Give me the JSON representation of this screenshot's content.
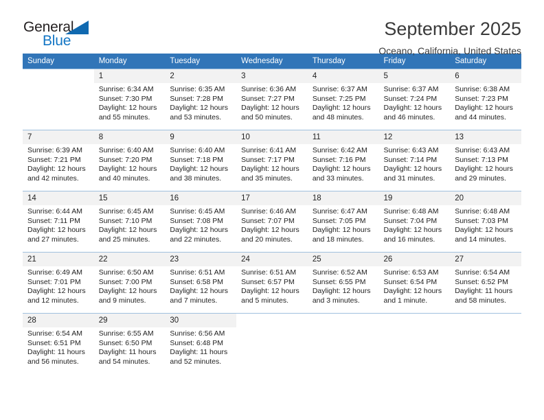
{
  "brand": {
    "name_top": "General",
    "name_bottom": "Blue",
    "triangle_color": "#1069b0",
    "blue_color": "#1275c4"
  },
  "header": {
    "title": "September 2025",
    "subtitle": "Oceano, California, United States"
  },
  "theme": {
    "header_blue": "#3175b8",
    "daynum_bg": "#f2f2f2",
    "row_divider": "#9fc0de"
  },
  "calendar": {
    "weekdays": [
      "Sunday",
      "Monday",
      "Tuesday",
      "Wednesday",
      "Thursday",
      "Friday",
      "Saturday"
    ],
    "weeks": [
      [
        {
          "day": "",
          "sunrise": "",
          "sunset": "",
          "daylight_a": "",
          "daylight_b": ""
        },
        {
          "day": "1",
          "sunrise": "Sunrise: 6:34 AM",
          "sunset": "Sunset: 7:30 PM",
          "daylight_a": "Daylight: 12 hours",
          "daylight_b": "and 55 minutes."
        },
        {
          "day": "2",
          "sunrise": "Sunrise: 6:35 AM",
          "sunset": "Sunset: 7:28 PM",
          "daylight_a": "Daylight: 12 hours",
          "daylight_b": "and 53 minutes."
        },
        {
          "day": "3",
          "sunrise": "Sunrise: 6:36 AM",
          "sunset": "Sunset: 7:27 PM",
          "daylight_a": "Daylight: 12 hours",
          "daylight_b": "and 50 minutes."
        },
        {
          "day": "4",
          "sunrise": "Sunrise: 6:37 AM",
          "sunset": "Sunset: 7:25 PM",
          "daylight_a": "Daylight: 12 hours",
          "daylight_b": "and 48 minutes."
        },
        {
          "day": "5",
          "sunrise": "Sunrise: 6:37 AM",
          "sunset": "Sunset: 7:24 PM",
          "daylight_a": "Daylight: 12 hours",
          "daylight_b": "and 46 minutes."
        },
        {
          "day": "6",
          "sunrise": "Sunrise: 6:38 AM",
          "sunset": "Sunset: 7:23 PM",
          "daylight_a": "Daylight: 12 hours",
          "daylight_b": "and 44 minutes."
        }
      ],
      [
        {
          "day": "7",
          "sunrise": "Sunrise: 6:39 AM",
          "sunset": "Sunset: 7:21 PM",
          "daylight_a": "Daylight: 12 hours",
          "daylight_b": "and 42 minutes."
        },
        {
          "day": "8",
          "sunrise": "Sunrise: 6:40 AM",
          "sunset": "Sunset: 7:20 PM",
          "daylight_a": "Daylight: 12 hours",
          "daylight_b": "and 40 minutes."
        },
        {
          "day": "9",
          "sunrise": "Sunrise: 6:40 AM",
          "sunset": "Sunset: 7:18 PM",
          "daylight_a": "Daylight: 12 hours",
          "daylight_b": "and 38 minutes."
        },
        {
          "day": "10",
          "sunrise": "Sunrise: 6:41 AM",
          "sunset": "Sunset: 7:17 PM",
          "daylight_a": "Daylight: 12 hours",
          "daylight_b": "and 35 minutes."
        },
        {
          "day": "11",
          "sunrise": "Sunrise: 6:42 AM",
          "sunset": "Sunset: 7:16 PM",
          "daylight_a": "Daylight: 12 hours",
          "daylight_b": "and 33 minutes."
        },
        {
          "day": "12",
          "sunrise": "Sunrise: 6:43 AM",
          "sunset": "Sunset: 7:14 PM",
          "daylight_a": "Daylight: 12 hours",
          "daylight_b": "and 31 minutes."
        },
        {
          "day": "13",
          "sunrise": "Sunrise: 6:43 AM",
          "sunset": "Sunset: 7:13 PM",
          "daylight_a": "Daylight: 12 hours",
          "daylight_b": "and 29 minutes."
        }
      ],
      [
        {
          "day": "14",
          "sunrise": "Sunrise: 6:44 AM",
          "sunset": "Sunset: 7:11 PM",
          "daylight_a": "Daylight: 12 hours",
          "daylight_b": "and 27 minutes."
        },
        {
          "day": "15",
          "sunrise": "Sunrise: 6:45 AM",
          "sunset": "Sunset: 7:10 PM",
          "daylight_a": "Daylight: 12 hours",
          "daylight_b": "and 25 minutes."
        },
        {
          "day": "16",
          "sunrise": "Sunrise: 6:45 AM",
          "sunset": "Sunset: 7:08 PM",
          "daylight_a": "Daylight: 12 hours",
          "daylight_b": "and 22 minutes."
        },
        {
          "day": "17",
          "sunrise": "Sunrise: 6:46 AM",
          "sunset": "Sunset: 7:07 PM",
          "daylight_a": "Daylight: 12 hours",
          "daylight_b": "and 20 minutes."
        },
        {
          "day": "18",
          "sunrise": "Sunrise: 6:47 AM",
          "sunset": "Sunset: 7:05 PM",
          "daylight_a": "Daylight: 12 hours",
          "daylight_b": "and 18 minutes."
        },
        {
          "day": "19",
          "sunrise": "Sunrise: 6:48 AM",
          "sunset": "Sunset: 7:04 PM",
          "daylight_a": "Daylight: 12 hours",
          "daylight_b": "and 16 minutes."
        },
        {
          "day": "20",
          "sunrise": "Sunrise: 6:48 AM",
          "sunset": "Sunset: 7:03 PM",
          "daylight_a": "Daylight: 12 hours",
          "daylight_b": "and 14 minutes."
        }
      ],
      [
        {
          "day": "21",
          "sunrise": "Sunrise: 6:49 AM",
          "sunset": "Sunset: 7:01 PM",
          "daylight_a": "Daylight: 12 hours",
          "daylight_b": "and 12 minutes."
        },
        {
          "day": "22",
          "sunrise": "Sunrise: 6:50 AM",
          "sunset": "Sunset: 7:00 PM",
          "daylight_a": "Daylight: 12 hours",
          "daylight_b": "and 9 minutes."
        },
        {
          "day": "23",
          "sunrise": "Sunrise: 6:51 AM",
          "sunset": "Sunset: 6:58 PM",
          "daylight_a": "Daylight: 12 hours",
          "daylight_b": "and 7 minutes."
        },
        {
          "day": "24",
          "sunrise": "Sunrise: 6:51 AM",
          "sunset": "Sunset: 6:57 PM",
          "daylight_a": "Daylight: 12 hours",
          "daylight_b": "and 5 minutes."
        },
        {
          "day": "25",
          "sunrise": "Sunrise: 6:52 AM",
          "sunset": "Sunset: 6:55 PM",
          "daylight_a": "Daylight: 12 hours",
          "daylight_b": "and 3 minutes."
        },
        {
          "day": "26",
          "sunrise": "Sunrise: 6:53 AM",
          "sunset": "Sunset: 6:54 PM",
          "daylight_a": "Daylight: 12 hours",
          "daylight_b": "and 1 minute."
        },
        {
          "day": "27",
          "sunrise": "Sunrise: 6:54 AM",
          "sunset": "Sunset: 6:52 PM",
          "daylight_a": "Daylight: 11 hours",
          "daylight_b": "and 58 minutes."
        }
      ],
      [
        {
          "day": "28",
          "sunrise": "Sunrise: 6:54 AM",
          "sunset": "Sunset: 6:51 PM",
          "daylight_a": "Daylight: 11 hours",
          "daylight_b": "and 56 minutes."
        },
        {
          "day": "29",
          "sunrise": "Sunrise: 6:55 AM",
          "sunset": "Sunset: 6:50 PM",
          "daylight_a": "Daylight: 11 hours",
          "daylight_b": "and 54 minutes."
        },
        {
          "day": "30",
          "sunrise": "Sunrise: 6:56 AM",
          "sunset": "Sunset: 6:48 PM",
          "daylight_a": "Daylight: 11 hours",
          "daylight_b": "and 52 minutes."
        },
        {
          "day": "",
          "sunrise": "",
          "sunset": "",
          "daylight_a": "",
          "daylight_b": ""
        },
        {
          "day": "",
          "sunrise": "",
          "sunset": "",
          "daylight_a": "",
          "daylight_b": ""
        },
        {
          "day": "",
          "sunrise": "",
          "sunset": "",
          "daylight_a": "",
          "daylight_b": ""
        },
        {
          "day": "",
          "sunrise": "",
          "sunset": "",
          "daylight_a": "",
          "daylight_b": ""
        }
      ]
    ]
  }
}
